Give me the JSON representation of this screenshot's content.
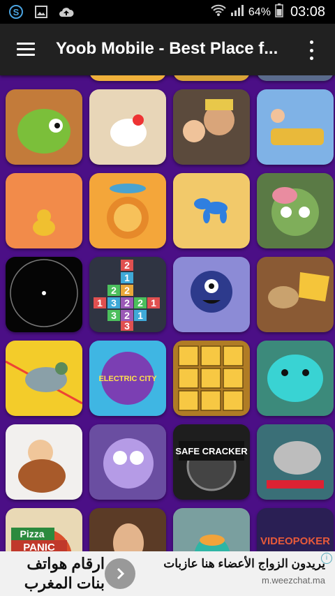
{
  "status_bar": {
    "icons": [
      "skype-icon",
      "gallery-icon",
      "cloud-upload-icon",
      "wifi-icon",
      "signal-icon",
      "battery-icon"
    ],
    "battery": "64%",
    "time": "03:08"
  },
  "app_bar": {
    "title": "Yoob Mobile - Best Place f..."
  },
  "games": [
    {
      "name": "dragon-game",
      "row": 0,
      "col": 0,
      "bg": "#c37b3a"
    },
    {
      "name": "chicken-game",
      "row": 0,
      "col": 1,
      "bg": "#e8d6b8"
    },
    {
      "name": "miner-game",
      "row": 0,
      "col": 2,
      "bg": "#5b4a3c"
    },
    {
      "name": "rollercoaster-game",
      "row": 0,
      "col": 3,
      "bg": "#7fb2e6"
    },
    {
      "name": "duck-game",
      "row": 1,
      "col": 0,
      "bg": "#f28b4a"
    },
    {
      "name": "lion-game",
      "row": 1,
      "col": 1,
      "bg": "#f4a63a"
    },
    {
      "name": "balloon-dog-game",
      "row": 1,
      "col": 2,
      "bg": "#f2c96a"
    },
    {
      "name": "zombie-game",
      "row": 1,
      "col": 3,
      "bg": "#5a7a45"
    },
    {
      "name": "circle-game",
      "row": 2,
      "col": 0,
      "bg": "#050505"
    },
    {
      "name": "number-blocks-game",
      "row": 2,
      "col": 1,
      "bg": "#2f3442"
    },
    {
      "name": "monster-game",
      "row": 2,
      "col": 2,
      "bg": "#8c8bd6"
    },
    {
      "name": "cheese-mouse-game",
      "row": 2,
      "col": 3,
      "bg": "#8a5a34"
    },
    {
      "name": "pigeon-game",
      "row": 3,
      "col": 0,
      "bg": "#f3cc2a"
    },
    {
      "name": "electric-city-game",
      "row": 3,
      "col": 1,
      "bg": "#3fb6e3"
    },
    {
      "name": "block-faces-game",
      "row": 3,
      "col": 2,
      "bg": "#b07c25"
    },
    {
      "name": "blob-game",
      "row": 3,
      "col": 3,
      "bg": "#3c8a7b"
    },
    {
      "name": "dwarf-game",
      "row": 4,
      "col": 0,
      "bg": "#f2f0ee"
    },
    {
      "name": "cartoon-lamb-game",
      "row": 4,
      "col": 1,
      "bg": "#6a4ea1"
    },
    {
      "name": "safe-cracker-game",
      "row": 4,
      "col": 2,
      "bg": "#1e1e1e"
    },
    {
      "name": "elephant-game",
      "row": 4,
      "col": 3,
      "bg": "#3a6f77"
    },
    {
      "name": "pizza-panic-game",
      "row": 5,
      "col": 0,
      "bg": "#e9d9b5"
    },
    {
      "name": "agent-game",
      "row": 5,
      "col": 1,
      "bg": "#5b3b26"
    },
    {
      "name": "platypus-game",
      "row": 5,
      "col": 2,
      "bg": "#7a9f9f"
    },
    {
      "name": "video-poker-game",
      "row": 5,
      "col": 3,
      "bg": "#2a1f54"
    }
  ],
  "tile_text": {
    "number_blocks": [
      "2",
      "1",
      "2",
      "2",
      "1",
      "3",
      "2",
      "2",
      "1",
      "3",
      "2",
      "1",
      "3"
    ],
    "electric_city": "ELECTRIC CITY",
    "safe_cracker": "SAFE CRACKER",
    "pizza": "Pizza",
    "panic": "PANIC",
    "video_poker": "VIDEOPOKER"
  },
  "ad": {
    "left_line1": "ارقام هواتف",
    "left_line2": "بنات المغرب",
    "headline": "يريدون الزواج الأعضاء هنا عازبات",
    "url": "m.weezchat.ma",
    "info": "i"
  }
}
